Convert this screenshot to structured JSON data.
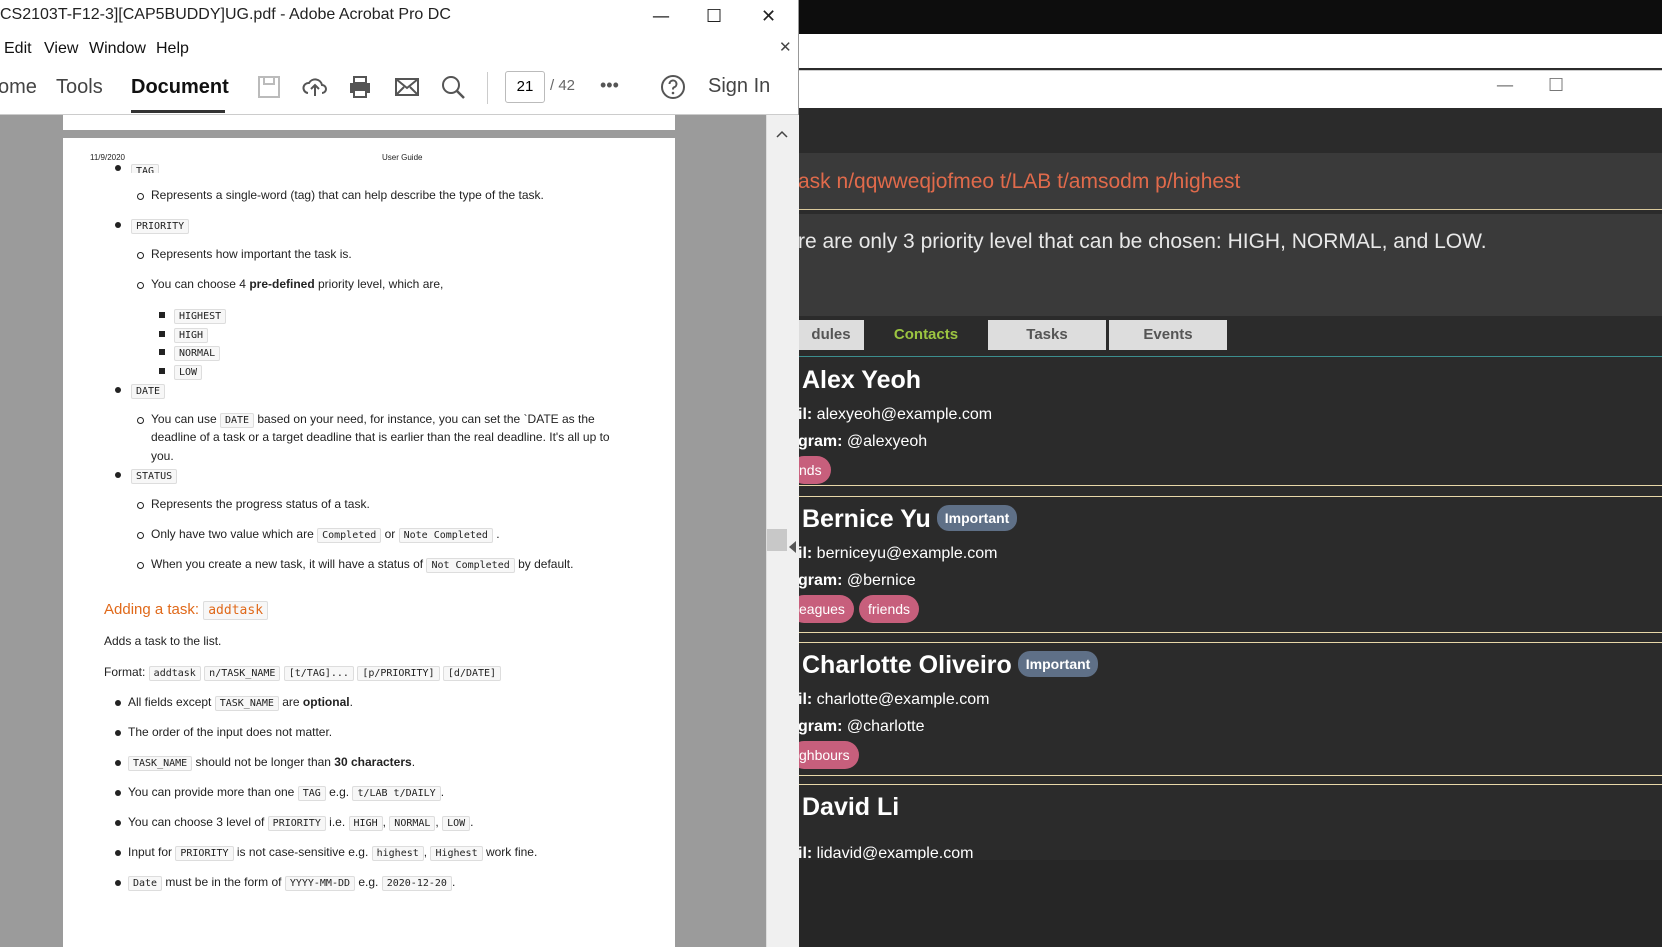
{
  "acrobat": {
    "title": "CS2103T-F12-3][CAP5BUDDY]UG.pdf - Adobe Acrobat Pro DC",
    "controls": {
      "min": "—",
      "max": "☐",
      "close": "✕"
    },
    "menu": [
      "Edit",
      "View",
      "Window",
      "Help"
    ],
    "close_doc": "✕",
    "toolbar": {
      "tabs": [
        "ome",
        "Tools",
        "Document"
      ],
      "page_current": "21",
      "page_total": "/  42",
      "more": "•••",
      "signin": "Sign In"
    },
    "doc": {
      "header_date": "11/9/2020",
      "header_title": "User Guide",
      "tag_label": "TAG",
      "tag_desc": "Represents a single-word (tag) that can help describe the type of the task.",
      "priority_label": "PRIORITY",
      "priority_desc": "Represents how important the task is.",
      "priority_choose_a": "You can choose 4 ",
      "priority_choose_b": "pre-defined",
      "priority_choose_c": " priority level, which are,",
      "priority_levels": [
        "HIGHEST",
        "HIGH",
        "NORMAL",
        "LOW"
      ],
      "date_label": "DATE",
      "date_line1_a": "You can use ",
      "date_line1_code": "DATE",
      "date_line1_b": " based on your need, for instance, you can set the `DATE as the",
      "date_line2": "deadline of a task or a target deadline that is earlier than the real deadline. It's all up to",
      "date_line3": "you.",
      "status_label": "STATUS",
      "status_desc1": "Represents the progress status of a task.",
      "status_desc2_a": "Only have two value which are ",
      "status_desc2_c1": "Completed",
      "status_desc2_b": " or ",
      "status_desc2_c2": "Note Completed",
      "status_desc2_d": " .",
      "status_desc3_a": "When you create a new task, it will have a status of ",
      "status_desc3_code": "Not Completed",
      "status_desc3_b": " by default.",
      "adding_heading": "Adding a task: ",
      "adding_code": "addtask",
      "adding_desc": "Adds a task to the list.",
      "format_label": "Format: ",
      "format_codes": [
        "addtask",
        "n/TASK_NAME",
        "[t/TAG]...",
        "[p/PRIORITY]",
        "[d/DATE]"
      ],
      "b1_a": "All fields except ",
      "b1_code": "TASK_NAME",
      "b1_b": " are ",
      "b1_bold": "optional",
      "b1_c": ".",
      "b2": "The order of the input does not matter.",
      "b3_code": "TASK_NAME",
      "b3_a": " should not be longer than ",
      "b3_bold": "30 characters",
      "b3_b": ".",
      "b4_a": "You can provide more than one ",
      "b4_code1": "TAG",
      "b4_b": " e.g. ",
      "b4_code2": "t/LAB t/DAILY",
      "b4_c": ".",
      "b5_a": "You can choose 3 level of ",
      "b5_code1": "PRIORITY",
      "b5_b": " i.e. ",
      "b5_code2": "HIGH",
      "b5_c": ", ",
      "b5_code3": "NORMAL",
      "b5_d": ", ",
      "b5_code4": "LOW",
      "b5_e": ".",
      "b6_a": "Input for ",
      "b6_code1": "PRIORITY",
      "b6_b": " is not case-sensitive e.g. ",
      "b6_code2": "highest",
      "b6_c": ", ",
      "b6_code3": "Highest",
      "b6_d": " work fine.",
      "b7_code1": "Date",
      "b7_a": " must be in the form of ",
      "b7_code2": "YYYY-MM-DD",
      "b7_b": " e.g. ",
      "b7_code3": "2020-12-20",
      "b7_c": "."
    }
  },
  "app": {
    "controls": {
      "min": "—",
      "max": "☐"
    },
    "command": "ask n/qqwweqjofmeo t/LAB t/amsodm p/highest",
    "result": "re are only 3 priority level that can be chosen: HIGH, NORMAL, and LOW.",
    "tabs": [
      "dules",
      "Contacts",
      "Tasks",
      "Events"
    ],
    "contacts": [
      {
        "name": "Alex Yeoh",
        "badge": "",
        "email_label": "il:",
        "email": "alexyeoh@example.com",
        "tg_label": "gram:",
        "tg": "@alexyeoh",
        "tags": [
          "nds"
        ]
      },
      {
        "name": "Bernice Yu",
        "badge": "Important",
        "email_label": "il:",
        "email": "berniceyu@example.com",
        "tg_label": "gram:",
        "tg": "@bernice",
        "tags": [
          "eagues",
          "friends"
        ]
      },
      {
        "name": "Charlotte Oliveiro",
        "badge": "Important",
        "email_label": "il:",
        "email": "charlotte@example.com",
        "tg_label": "gram:",
        "tg": "@charlotte",
        "tags": [
          "ghbours"
        ]
      },
      {
        "name": "David Li",
        "badge": "",
        "email_label": "il:",
        "email": "lidavid@example.com"
      }
    ]
  }
}
